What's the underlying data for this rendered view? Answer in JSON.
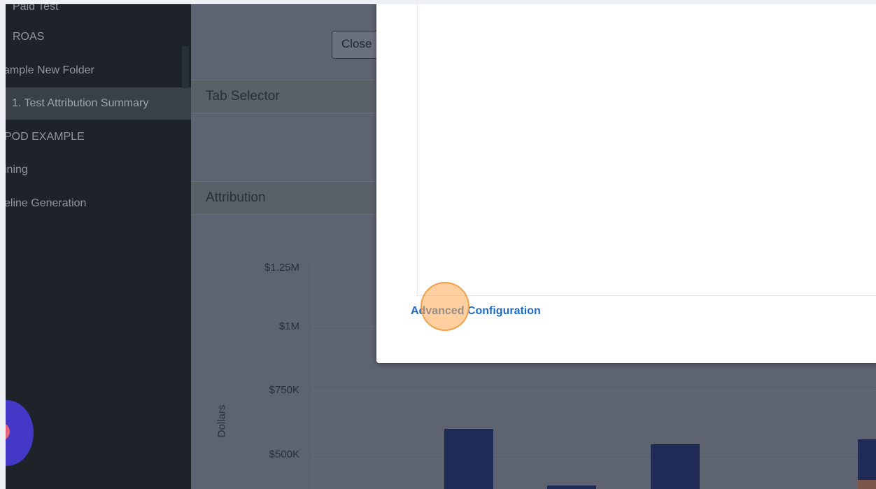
{
  "sidebar": {
    "items": [
      {
        "label": "Paid Test",
        "selected": false
      },
      {
        "label": "ROAS",
        "selected": false
      },
      {
        "label": "ample New Folder",
        "selected": false
      },
      {
        "label": "1. Test Attribution Summary",
        "selected": true
      },
      {
        "label": "POD EXAMPLE",
        "selected": false
      },
      {
        "label": "ining",
        "selected": false
      },
      {
        "label": "eline Generation",
        "selected": false
      }
    ]
  },
  "main": {
    "close_button": "Close",
    "sections": [
      "Tab Selector",
      "Attribution"
    ]
  },
  "chart_data": {
    "type": "bar",
    "ylabel": "Dollars",
    "y_ticks": [
      "$1.25M",
      "$1M",
      "$750K",
      "$500K"
    ],
    "ylim": [
      0,
      1250000
    ],
    "series": [
      {
        "values": [
          600000,
          380000,
          540000,
          560000
        ],
        "color": "#1f2a57"
      }
    ]
  },
  "modal": {
    "advanced_config_link": "Advanced Configuration"
  },
  "colors": {
    "link": "#1a6bc7",
    "sidebar_bg": "#1e2329",
    "overlay_bg": "#5d6370",
    "bar": "#1f2a57",
    "fab": "#4438c6",
    "click_marker": "#f5b064"
  }
}
